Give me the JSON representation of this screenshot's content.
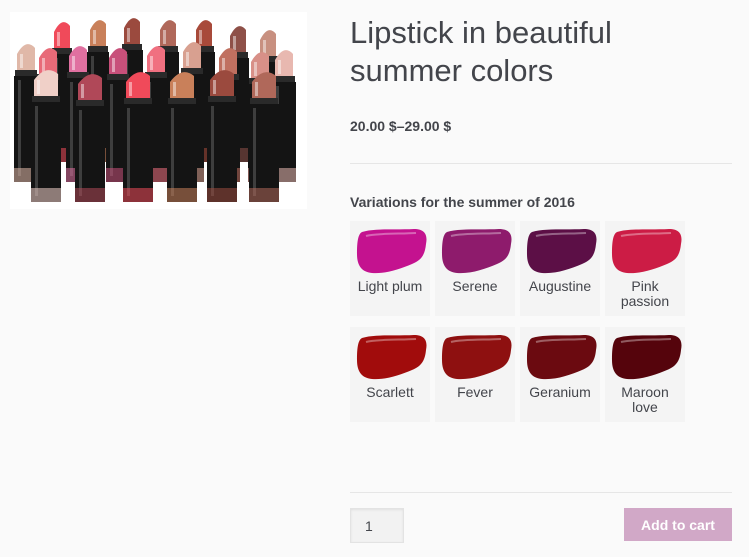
{
  "product": {
    "title_line1": "Lipstick in beautiful",
    "title_line2": "summer colors",
    "price": "20.00 $–29.00 $"
  },
  "variations": {
    "label": "Variations for the summer of 2016",
    "swatches": [
      {
        "name": "Light plum",
        "line1": "Light plum",
        "line2": "",
        "color": "#c4128f"
      },
      {
        "name": "Serene",
        "line1": "Serene",
        "line2": "",
        "color": "#8e1b6c"
      },
      {
        "name": "Augustine",
        "line1": "Augustine",
        "line2": "",
        "color": "#5c0f46"
      },
      {
        "name": "Pink passion",
        "line1": "Pink",
        "line2": "passion",
        "color": "#cc1c45"
      },
      {
        "name": "Scarlett",
        "line1": "Scarlett",
        "line2": "",
        "color": "#a10c0c"
      },
      {
        "name": "Fever",
        "line1": "Fever",
        "line2": "",
        "color": "#8e1010"
      },
      {
        "name": "Geranium",
        "line1": "Geranium",
        "line2": "",
        "color": "#6b0a10"
      },
      {
        "name": "Maroon love",
        "line1": "Maroon",
        "line2": "love",
        "color": "#55040c"
      }
    ]
  },
  "cart": {
    "quantity": "1",
    "add_to_cart_label": "Add to cart",
    "button_color": "#d1a8c7"
  },
  "product_image": {
    "icon": "lipstick-collection-photo",
    "lipstick_colors": [
      "#f04a5a",
      "#c9805a",
      "#9b4a3e",
      "#b0685a",
      "#a84a3a",
      "#8e5048",
      "#c89080",
      "#e0b8a8",
      "#e86a78",
      "#e070a0",
      "#c8507a",
      "#f07080",
      "#d8a090",
      "#c07060",
      "#d89088",
      "#e8b8b0",
      "#f0d0c8",
      "#b04858"
    ]
  }
}
